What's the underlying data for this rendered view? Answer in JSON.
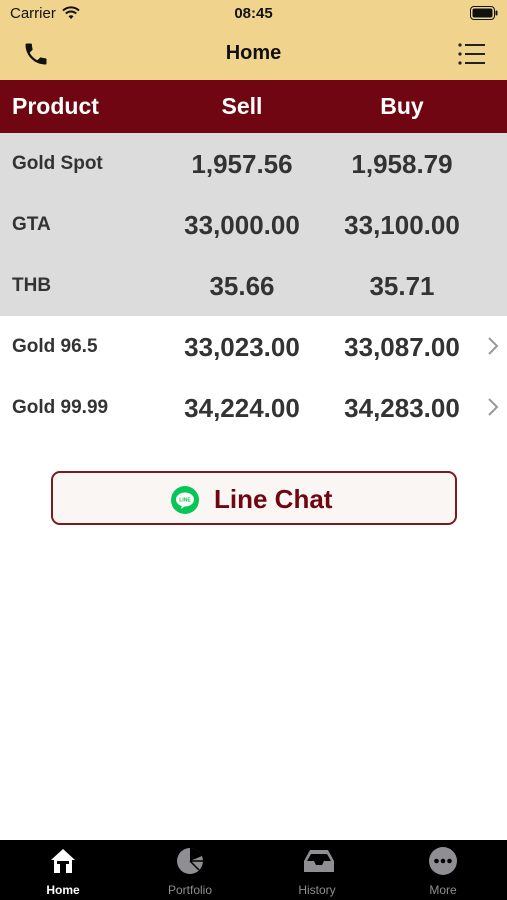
{
  "status_bar": {
    "carrier": "Carrier",
    "time": "08:45"
  },
  "nav": {
    "title": "Home",
    "left_icon": "phone-icon",
    "right_icon": "list-icon"
  },
  "table": {
    "headers": {
      "product": "Product",
      "sell": "Sell",
      "buy": "Buy"
    },
    "rows": [
      {
        "name": "Gold Spot",
        "sell": "1,957.56",
        "buy": "1,958.79"
      },
      {
        "name": "GTA",
        "sell": "33,000.00",
        "buy": "33,100.00"
      },
      {
        "name": "THB",
        "sell": "35.66",
        "buy": "35.71"
      },
      {
        "name": "Gold 96.5",
        "sell": "33,023.00",
        "buy": "33,087.00"
      },
      {
        "name": "Gold 99.99",
        "sell": "34,224.00",
        "buy": "34,283.00"
      }
    ]
  },
  "line_chat": {
    "label": "Line Chat",
    "icon": "line-icon",
    "icon_text": "LINE"
  },
  "tabs": [
    {
      "label": "Home",
      "icon": "home-icon",
      "active": true
    },
    {
      "label": "Portfolio",
      "icon": "pie-chart-icon",
      "active": false
    },
    {
      "label": "History",
      "icon": "inbox-icon",
      "active": false
    },
    {
      "label": "More",
      "icon": "more-icon",
      "active": false
    }
  ],
  "colors": {
    "header_bg": "#f0d48e",
    "accent": "#6f0611",
    "row_gray": "#dcdcdc",
    "line_green": "#06c755",
    "tab_bg": "#000000"
  }
}
